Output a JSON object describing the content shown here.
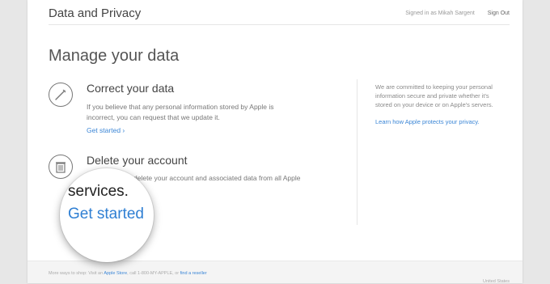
{
  "header": {
    "title": "Data and Privacy",
    "signed_in": "Signed in as Mikah Sargent",
    "sign_out": "Sign Out"
  },
  "main": {
    "title": "Manage your data",
    "correct": {
      "icon": "pencil-icon",
      "title": "Correct your data",
      "text_line1": "If you believe that any personal information stored by Apple is",
      "text_line2": "incorrect, you can request that we update it.",
      "link": "Get started ›"
    },
    "delete": {
      "icon": "trash-icon",
      "title": "Delete your account",
      "text_line1": "delete your account and associated data from all Apple",
      "link": "Get started"
    }
  },
  "aside": {
    "text_line1": "We are committed to keeping your personal",
    "text_line2": "information secure and private whether it's",
    "text_line3": "stored on your device or on Apple's servers.",
    "link": "Learn how Apple protects your privacy."
  },
  "magnifier": {
    "text": "services.",
    "link": "Get started"
  },
  "footer": {
    "shop_prefix": "More ways to shop: Visit an",
    "apple_store": "Apple Store",
    "call": ", call 1-800-MY-APPLE, or",
    "find_reseller": "find a reseller",
    "region": "United States"
  },
  "colors": {
    "link": "#3b86d6",
    "background": "#e7e7e7"
  }
}
